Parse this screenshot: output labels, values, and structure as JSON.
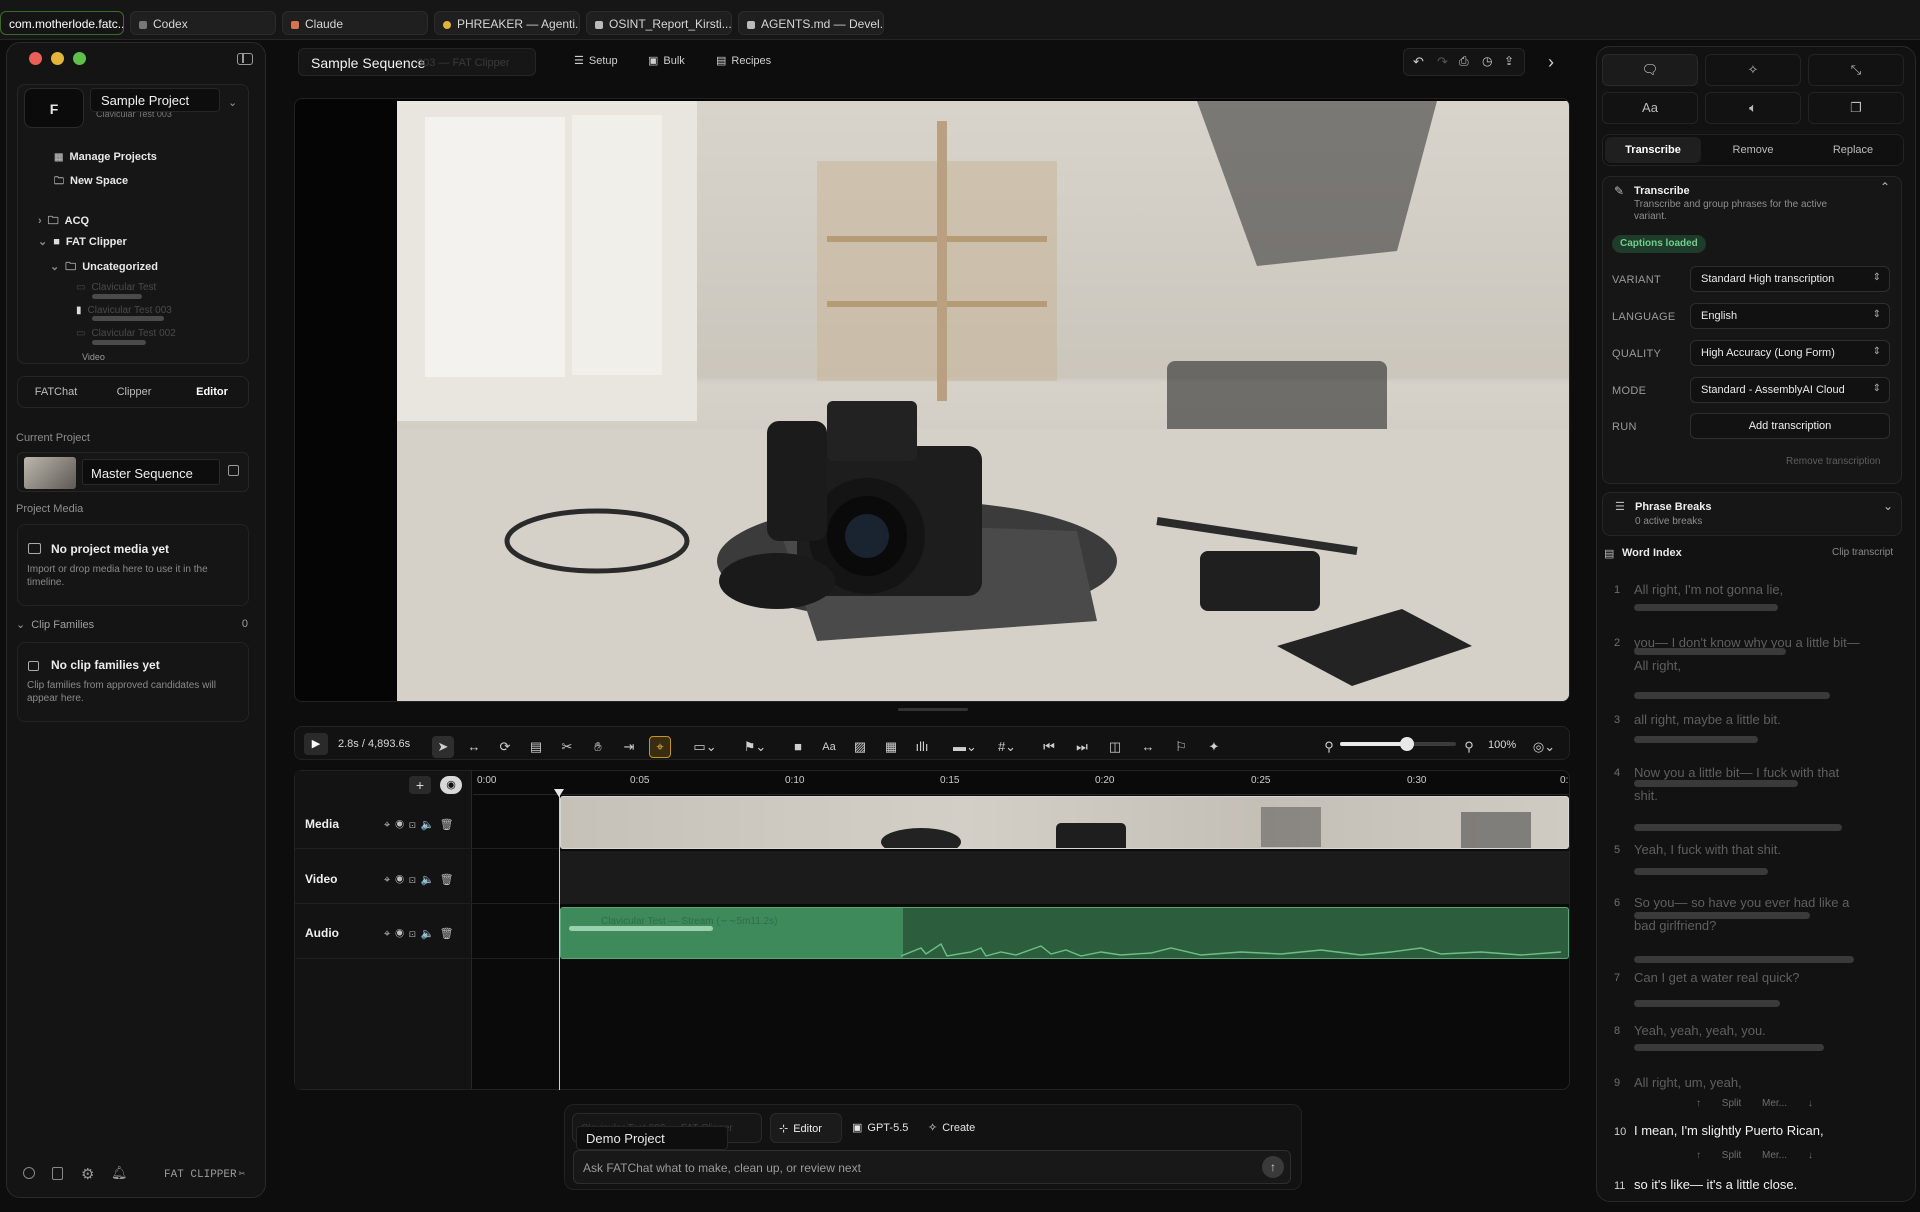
{
  "browser": {
    "tabs": [
      {
        "label": "com.motherlode.fatc...",
        "color": "#3a6b2a"
      },
      {
        "label": "Codex",
        "color": "#9a9a9a"
      },
      {
        "label": "Claude",
        "color": "#d9734e"
      },
      {
        "label": "PHREAKER — Agenti...",
        "color": "#e0b33a"
      },
      {
        "label": "OSINT_Report_Kirsti...",
        "color": "#bbbbbb"
      },
      {
        "label": "AGENTS.md — Devel...",
        "color": "#bbbbbb"
      }
    ]
  },
  "sidebar": {
    "avatar_letter": "F",
    "project_name": "Sample Project",
    "project_sub": "Clavicular Test 003",
    "menu": {
      "manage": "Manage Projects",
      "new_space": "New Space"
    },
    "tree": {
      "acq": "ACQ",
      "fat_clipper": "FAT Clipper",
      "uncategorized": "Uncategorized",
      "items": [
        "Clavicular Test",
        "Clavicular Test 003",
        "Clavicular Test 002"
      ],
      "more": "Video"
    },
    "tabs": {
      "fatchat": "FATChat",
      "clipper": "Clipper",
      "editor": "Editor"
    },
    "current_project_heading": "Current Project",
    "current_project_name": "Master Sequence",
    "project_media_heading": "Project Media",
    "no_media_title": "No project media yet",
    "no_media_desc": "Import or drop media here to use it in the timeline.",
    "clip_families_heading": "Clip Families",
    "clip_families_count": "0",
    "no_clip_title": "No clip families yet",
    "no_clip_desc": "Clip families from approved candidates will appear here.",
    "brand": "FAT CLIPPER"
  },
  "header": {
    "sequence": "Sample Sequence",
    "sequence_ghost": "003 — FAT Clipper",
    "setup": "Setup",
    "bulk": "Bulk",
    "recipes": "Recipes"
  },
  "transport": {
    "time": "2.8s / 4,893.6s",
    "zoom": "100%",
    "zoom_level": 0.58
  },
  "timeline": {
    "ticks": [
      "0:00",
      "0:05",
      "0:10",
      "0:15",
      "0:20",
      "0:25",
      "0:30",
      "0:"
    ],
    "tracks": {
      "media": "Media",
      "video": "Video",
      "audio": "Audio"
    },
    "controls": "⌖◉⊡🔈🗑",
    "audio_ghost": "Clavicular Test — Stream (∼∼5m11.2s)"
  },
  "chat": {
    "ghost_context": "Clavicular Test 003 — FAT Clipper",
    "popup": "Demo Project",
    "mode": "Editor",
    "model": "GPT-5.5",
    "create": "Create",
    "placeholder": "Ask FATChat what to make, clean up, or review next"
  },
  "right": {
    "tabs": {
      "transcribe": "Transcribe",
      "remove": "Remove",
      "replace": "Replace"
    },
    "section_title": "Transcribe",
    "section_desc": "Transcribe and group phrases for the active variant.",
    "badge": "Captions loaded",
    "fields": {
      "variant_label": "VARIANT",
      "variant": "Standard High transcription",
      "language_label": "LANGUAGE",
      "language": "English",
      "quality_label": "QUALITY",
      "quality": "High Accuracy (Long Form)",
      "mode_label": "MODE",
      "mode": "Standard - AssemblyAI Cloud",
      "run_label": "RUN",
      "run": "Add transcription"
    },
    "remove_link": "Remove transcription",
    "phrase_title": "Phrase Breaks",
    "phrase_sub": "0 active breaks",
    "word_index": "Word Index",
    "clip_transcript": "Clip transcript",
    "entries": [
      {
        "n": "1",
        "text": "All right, I'm not gonna lie,"
      },
      {
        "n": "2",
        "text": "you— I don't know why you a little bit—"
      },
      {
        "n": "",
        "text": "All right,"
      },
      {
        "n": "3",
        "text": "all right, maybe a little bit."
      },
      {
        "n": "4",
        "text": "Now you a little bit— I fuck with that"
      },
      {
        "n": "",
        "text": "shit."
      },
      {
        "n": "5",
        "text": "Yeah, I fuck with that shit."
      },
      {
        "n": "6",
        "text": "So you— so have you ever had like a"
      },
      {
        "n": "",
        "text": "bad girlfriend?"
      },
      {
        "n": "7",
        "text": "Can I get a water real quick?"
      },
      {
        "n": "8",
        "text": "Yeah, yeah, yeah, you."
      },
      {
        "n": "9",
        "text": "All right, um, yeah,"
      },
      {
        "n": "10",
        "text": "I mean, I'm slightly Puerto Rican,"
      },
      {
        "n": "11",
        "text": "so it's like— it's a little close."
      }
    ],
    "row_actions": {
      "up": "↑",
      "split": "Split",
      "merge": "Mer...",
      "down": "↓"
    }
  }
}
